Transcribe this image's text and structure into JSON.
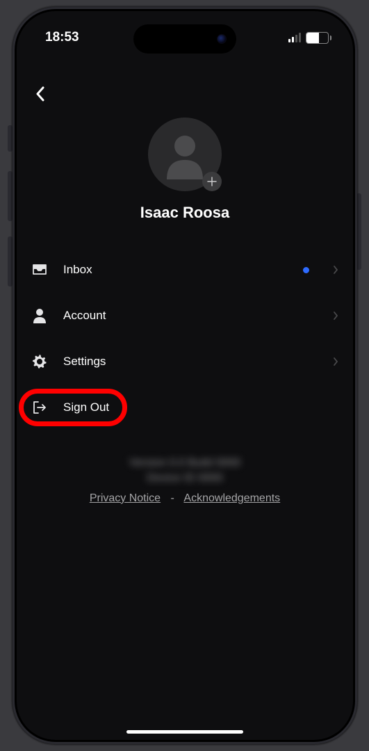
{
  "status": {
    "time": "18:53",
    "battery_percent": "57"
  },
  "profile": {
    "name": "Isaac Roosa"
  },
  "menu": {
    "inbox": {
      "label": "Inbox",
      "has_notification": true
    },
    "account": {
      "label": "Account"
    },
    "settings": {
      "label": "Settings"
    },
    "signout": {
      "label": "Sign Out"
    }
  },
  "footer": {
    "privacy": "Privacy Notice",
    "acknowledgements": "Acknowledgements",
    "separator": "-"
  }
}
